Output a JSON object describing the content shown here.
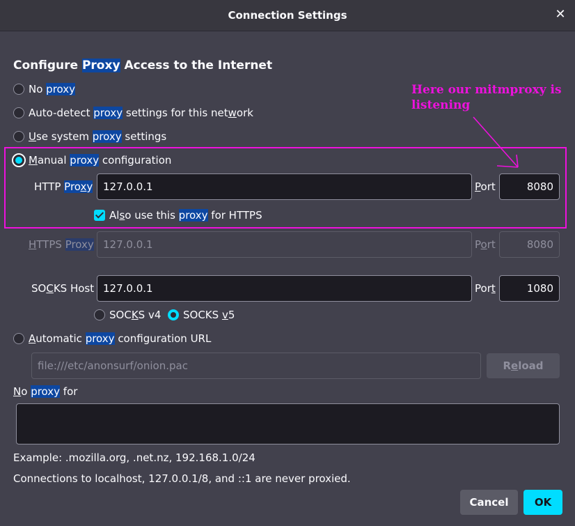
{
  "window": {
    "title": "Connection Settings",
    "close_glyph": "✕"
  },
  "section": {
    "pre": "Configure ",
    "hl": "Proxy",
    "post": " Access to the Internet"
  },
  "options": {
    "no_proxy": {
      "a": "No ",
      "b": "proxy"
    },
    "auto_detect": {
      "a": "Auto-detect ",
      "b": "proxy",
      "c": " settings for this net",
      "d": "w",
      "e": "ork"
    },
    "system": {
      "a": "U",
      "b": "se system ",
      "c": "proxy",
      "d": " settings"
    },
    "manual": {
      "a": "M",
      "b": "anual ",
      "c": "proxy",
      "d": " configuration"
    }
  },
  "http": {
    "label_a": "HTTP ",
    "label_b": "Pro",
    "label_c": "x",
    "label_d": "y",
    "value": "127.0.0.1",
    "port_a": "P",
    "port_b": "ort",
    "port": "8080"
  },
  "also_https": {
    "a": "Al",
    "b": "s",
    "c": "o use this ",
    "d": "proxy",
    "e": " for HTTPS"
  },
  "https": {
    "label_a": "H",
    "label_b": "TTPS ",
    "label_c": "Proxy",
    "value": "127.0.0.1",
    "port_a": "P",
    "port_b": "o",
    "port_c": "rt",
    "port": "8080"
  },
  "socks": {
    "label_a": "SO",
    "label_b": "C",
    "label_c": "KS Host",
    "value": "127.0.0.1",
    "port_a": "Por",
    "port_b": "t",
    "port": "1080",
    "v4_a": "SOC",
    "v4_b": "K",
    "v4_c": "S v4",
    "v5_a": "SOCKS ",
    "v5_b": "v",
    "v5_c": "5"
  },
  "auto_url": {
    "a": "A",
    "b": "utomatic ",
    "c": "proxy",
    "d": " configuration URL",
    "value": "file:///etc/anonsurf/onion.pac",
    "reload_a": "R",
    "reload_b": "e",
    "reload_c": "load"
  },
  "no_proxy_for": {
    "a": "N",
    "b": "o ",
    "c": "proxy",
    "d": " for",
    "value": ""
  },
  "example": "Example: .mozilla.org, .net.nz, 192.168.1.0/24",
  "localhost_note": "Connections to localhost, 127.0.0.1/8, and ::1 are never proxied.",
  "buttons": {
    "cancel": "Cancel",
    "ok": "OK"
  },
  "annotation": {
    "line1": "Here our mitmproxy is",
    "line2": "listening",
    "color": "#ee11dd"
  },
  "colors": {
    "accent": "#00ddff",
    "highlight": "#0d47a1",
    "background": "#42414d"
  }
}
